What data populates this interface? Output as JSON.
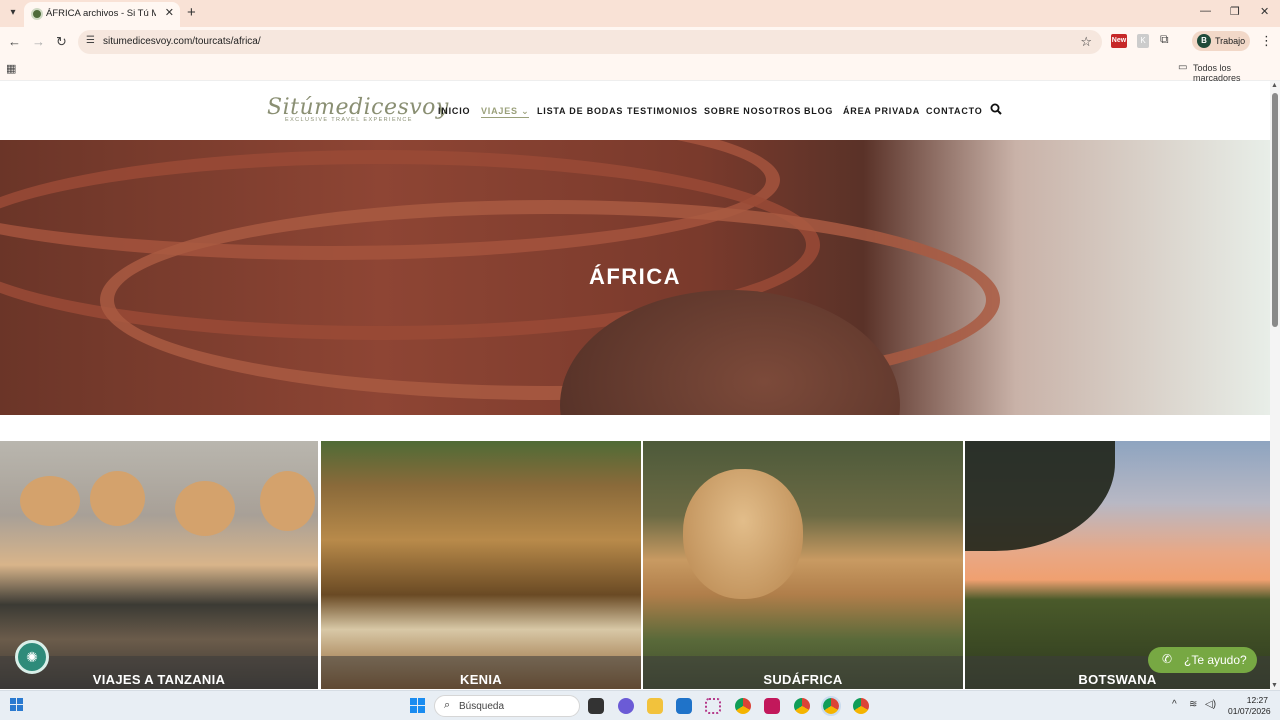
{
  "browser": {
    "tab_title": "ÁFRICA archivos - Si Tú Me Dic",
    "url": "situmedicesvoy.com/tourcats/africa/",
    "profile_initial": "B",
    "profile_label": "Trabajo",
    "extension_new_label": "New",
    "extension_k_label": "K",
    "bookmarks_label": "Todos los marcadores"
  },
  "site": {
    "logo_text": "Sitúmedicesvoy",
    "logo_tagline": "EXCLUSIVE TRAVEL EXPERIENCE",
    "nav": [
      {
        "label": "INICIO"
      },
      {
        "label": "VIAJES ⌄"
      },
      {
        "label": "LISTA DE BODAS"
      },
      {
        "label": "TESTIMONIOS"
      },
      {
        "label": "SOBRE NOSOTROS"
      },
      {
        "label": "BLOG"
      },
      {
        "label": "ÁREA PRIVADA"
      },
      {
        "label": "CONTACTO"
      }
    ],
    "active_nav": "VIAJES"
  },
  "hero": {
    "title": "ÁFRICA"
  },
  "cards": [
    {
      "label": "VIAJES A TANZANIA"
    },
    {
      "label": "KENIA"
    },
    {
      "label": "SUDÁFRICA"
    },
    {
      "label": "BOTSWANA"
    }
  ],
  "widgets": {
    "help_label": "¿Te ayudo?"
  },
  "taskbar": {
    "search_label": "Búsqueda",
    "time": "12:27",
    "date": "01/07/2026"
  },
  "colors": {
    "accent": "#9aa07a",
    "help_button": "#77a843",
    "tab_bar": "#f9e2d6"
  }
}
